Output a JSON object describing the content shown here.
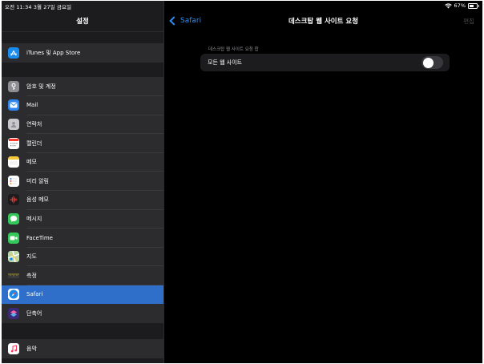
{
  "status_bar": {
    "time_date": "오전 11:34   3월 27일 금요일",
    "battery_text": "67%",
    "battery_level": 0.67
  },
  "sidebar": {
    "title": "설정",
    "groups": [
      {
        "items": [
          {
            "label": "iTunes 및 App Store",
            "icon": "app-store-icon",
            "color": "#1a8cf0"
          }
        ]
      },
      {
        "items": [
          {
            "label": "암호 및 계정",
            "icon": "key-icon",
            "color": "#8e8e93"
          },
          {
            "label": "Mail",
            "icon": "mail-icon",
            "color": "#2f86f1"
          },
          {
            "label": "연락처",
            "icon": "contacts-icon",
            "color": "#c7c7cc"
          },
          {
            "label": "캘린더",
            "icon": "calendar-icon",
            "color": "#ffffff"
          },
          {
            "label": "메모",
            "icon": "notes-icon",
            "color": "#ffffff"
          },
          {
            "label": "미리 알림",
            "icon": "reminders-icon",
            "color": "#ffffff"
          },
          {
            "label": "음성 메모",
            "icon": "voice-memos-icon",
            "color": "#1c1c1e"
          },
          {
            "label": "메시지",
            "icon": "messages-icon",
            "color": "#34c759"
          },
          {
            "label": "FaceTime",
            "icon": "facetime-icon",
            "color": "#34c759"
          },
          {
            "label": "지도",
            "icon": "maps-icon",
            "color": "#e8e0c8"
          },
          {
            "label": "측정",
            "icon": "measure-icon",
            "color": "#2c2c2e"
          },
          {
            "label": "Safari",
            "icon": "safari-icon",
            "color": "#ffffff",
            "selected": true
          },
          {
            "label": "단축어",
            "icon": "shortcuts-icon",
            "color": "#3a2a78"
          }
        ]
      },
      {
        "items": [
          {
            "label": "음악",
            "icon": "music-icon",
            "color": "#ffffff"
          }
        ]
      }
    ]
  },
  "navbar": {
    "back_label": "Safari",
    "title": "데스크탑 웹 사이트 요청",
    "edit_label": "편집"
  },
  "content": {
    "section_header": "데스크탑 웹 사이트 요청 합",
    "setting": {
      "label": "모든 웹 사이트",
      "enabled": false
    }
  },
  "colors": {
    "accent": "#2e8ef5",
    "selected_row": "#2f6fc9",
    "toggle_off": "#39393d"
  }
}
